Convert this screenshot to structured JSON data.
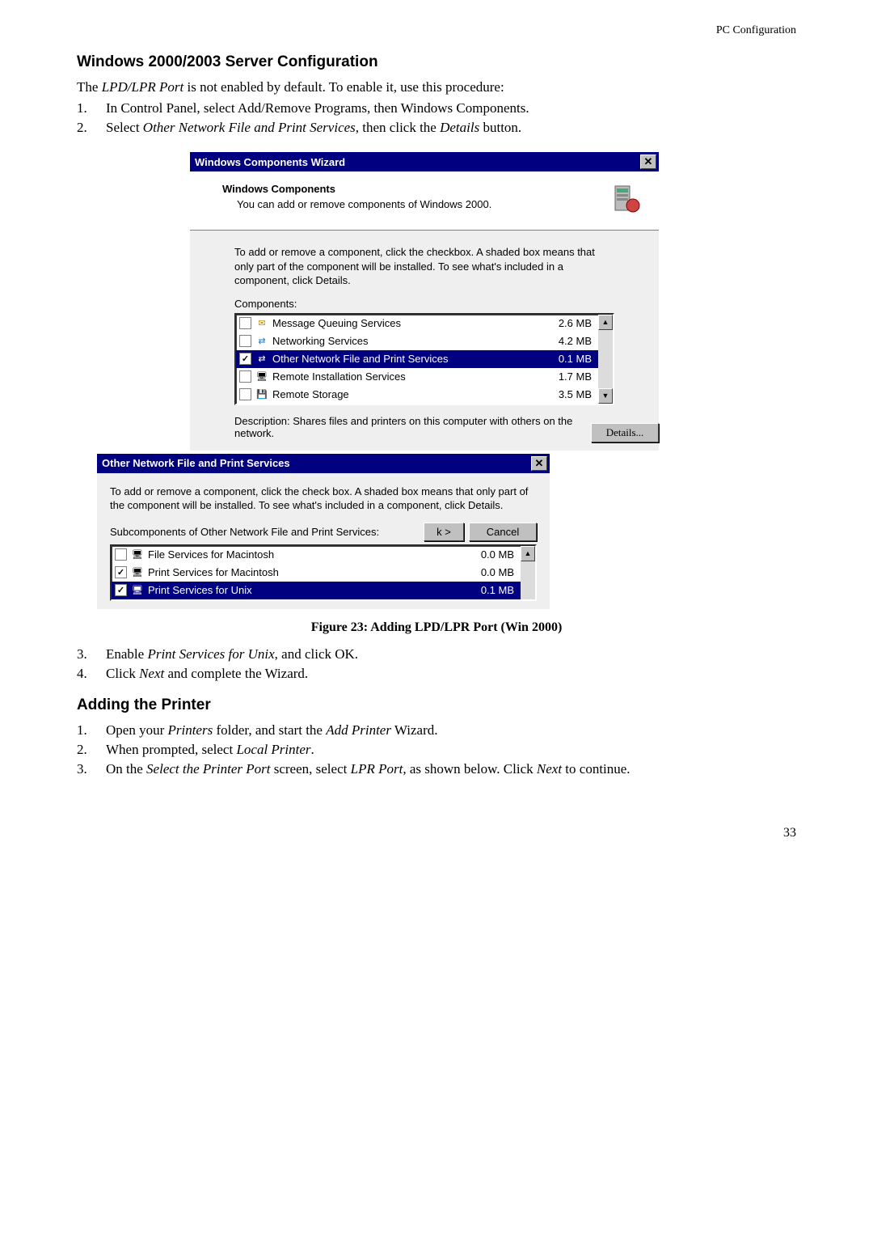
{
  "header": {
    "section": "PC Configuration"
  },
  "h1": "Windows 2000/2003 Server Configuration",
  "p1_a": "The ",
  "p1_em": "LPD/LPR Port",
  "p1_b": " is not enabled by default. To enable it, use this procedure:",
  "step1": {
    "num": "1.",
    "text": "In Control Panel, select Add/Remove Programs, then Windows Components."
  },
  "step2": {
    "num": "2.",
    "a": "Select ",
    "em1": "Other Network File and Print Services",
    "b": ", then click the ",
    "em2": "Details",
    "c": " button."
  },
  "wiz1": {
    "title": "Windows Components Wizard",
    "close": "✕",
    "banner_title": "Windows Components",
    "banner_sub": "You can add or remove components of Windows 2000.",
    "desc": "To add or remove a component, click the checkbox. A shaded box means that only part of the component will be installed. To see what's included in a component, click Details.",
    "comp_label": "Components:",
    "items": [
      {
        "checked": false,
        "icon": "✉",
        "label": "Message Queuing Services",
        "size": "2.6 MB",
        "sel": false
      },
      {
        "checked": false,
        "icon": "⇄",
        "label": "Networking Services",
        "size": "4.2 MB",
        "sel": false
      },
      {
        "checked": true,
        "icon": "⇄",
        "label": "Other Network File and Print Services",
        "size": "0.1 MB",
        "sel": true
      },
      {
        "checked": false,
        "icon": "🖥",
        "label": "Remote Installation Services",
        "size": "1.7 MB",
        "sel": false
      },
      {
        "checked": false,
        "icon": "💾",
        "label": "Remote Storage",
        "size": "3.5 MB",
        "sel": false
      }
    ],
    "desc_line": "Description:   Shares files and printers on this computer with others on the network.",
    "details_btn": "Details..."
  },
  "wiz2": {
    "title": "Other Network File and Print Services",
    "close": "✕",
    "desc": "To add or remove a component, click the check box. A shaded box means that only part of the component will be installed. To see what's included in a component, click Details.",
    "sub_label": "Subcomponents of Other Network File and Print Services:",
    "items": [
      {
        "checked": false,
        "icon": "🖥",
        "label": "File Services for Macintosh",
        "size": "0.0 MB",
        "sel": false
      },
      {
        "checked": true,
        "icon": "🖥",
        "label": "Print Services for Macintosh",
        "size": "0.0 MB",
        "sel": false
      },
      {
        "checked": true,
        "icon": "🖥",
        "label": "Print Services for Unix",
        "size": "0.1 MB",
        "sel": true
      }
    ],
    "back_btn": "k >",
    "cancel_btn": "Cancel"
  },
  "caption": "Figure 23: Adding LPD/LPR Port (Win 2000)",
  "step3": {
    "num": "3.",
    "a": "Enable ",
    "em": "Print Services for Unix",
    "b": ", and click OK."
  },
  "step4": {
    "num": "4.",
    "a": "Click ",
    "em": "Next",
    "b": " and complete the Wizard."
  },
  "h2": "Adding the Printer",
  "ap1": {
    "num": "1.",
    "a": "Open your ",
    "em1": "Printers",
    "b": " folder, and start the ",
    "em2": "Add Printer",
    "c": " Wizard."
  },
  "ap2": {
    "num": "2.",
    "a": "When prompted, select ",
    "em": "Local Printer",
    "b": "."
  },
  "ap3": {
    "num": "3.",
    "a": "On the ",
    "em1": "Select the Printer Port",
    "b": " screen, select ",
    "em2": "LPR Port",
    "c": ", as shown below. Click ",
    "em3": "Next",
    "d": " to continue."
  },
  "page_num": "33"
}
